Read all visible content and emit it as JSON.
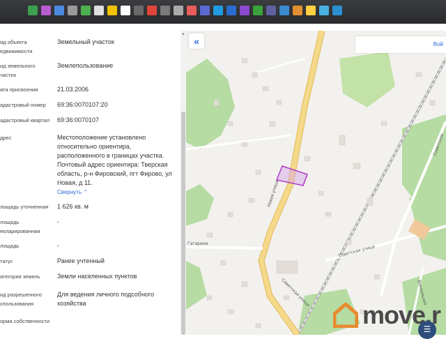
{
  "taskbar": {
    "icons": [
      {
        "name": "books-icon",
        "color": "#3d9e4f"
      },
      {
        "name": "photo-icon",
        "color": "#b85cd0"
      },
      {
        "name": "share-icon",
        "color": "#4b8ae0"
      },
      {
        "name": "pen-icon",
        "color": "#9a9a9a"
      },
      {
        "name": "plus-icon",
        "color": "#4caf50"
      },
      {
        "name": "file-icon",
        "color": "#e0e0e0"
      },
      {
        "name": "torrent-icon",
        "color": "#f2c200"
      },
      {
        "name": "amazon-icon",
        "color": "#ffffff"
      },
      {
        "name": "grid-icon",
        "color": "#6a6a6a"
      },
      {
        "name": "chrome-icon",
        "color": "#e04438"
      },
      {
        "name": "folder-icon",
        "color": "#7a7a7a"
      },
      {
        "name": "wrench-icon",
        "color": "#aaaaaa"
      },
      {
        "name": "mail-icon",
        "color": "#e85c5c"
      },
      {
        "name": "tools-icon",
        "color": "#5a6ad0"
      },
      {
        "name": "skype-icon",
        "color": "#1e9be0"
      },
      {
        "name": "psd-icon",
        "color": "#2b6cd0"
      },
      {
        "name": "pre-icon",
        "color": "#8c4ad0"
      },
      {
        "name": "terminal-icon",
        "color": "#3aa23a"
      },
      {
        "name": "media-icon",
        "color": "#6060a0"
      },
      {
        "name": "game-icon",
        "color": "#3a8ad0"
      },
      {
        "name": "flame-icon",
        "color": "#e09030"
      },
      {
        "name": "car-icon",
        "color": "#ffd040"
      },
      {
        "name": "browser-icon",
        "color": "#4ab0e0"
      },
      {
        "name": "edge-icon",
        "color": "#2a90d0"
      }
    ]
  },
  "property": {
    "rows": [
      {
        "label": "ид объекта\nедвижимости",
        "value": "Земельный участок"
      },
      {
        "label": "ид земельного\nчастка",
        "value": "Землепользование"
      },
      {
        "label": "ата присвоения",
        "value": "21.03.2006"
      },
      {
        "label": "адастровый номер",
        "value": "69:36:0070107:20"
      },
      {
        "label": "адастровый квартал",
        "value": "69:36:0070107"
      },
      {
        "label": "дрес",
        "value": "Местоположение установлено относительно ориентира, расположенного в границах участка. Почтовый адрес ориентира: Тверская область, р-н Фировский, пгт Фирово, ул Новая, д 11."
      },
      {
        "label": "лощадь уточненная",
        "value": "1 626 кв. м"
      },
      {
        "label": "лощадь\nекларированная",
        "value": "-"
      },
      {
        "label": "лощадь",
        "value": "-"
      },
      {
        "label": "татус",
        "value": "Ранее учтенный"
      },
      {
        "label": "атегория земель",
        "value": "Земли населенных пунктов"
      },
      {
        "label": "ид разрешенного\nспользования",
        "value": "Для ведения личного подсобного хозяйства"
      },
      {
        "label": "орма собственности",
        "value": ""
      }
    ],
    "collapse_label": "Свернуть",
    "collapse_icon": "chevron-up-icon"
  },
  "map": {
    "back_icon": "double-chevron-left-icon",
    "search_text": "Вой",
    "streets": {
      "novaya": "Новая улица",
      "gagarina": "Гагарина",
      "sovetskaya": "Советская улица",
      "sovetskaya2": "Советская",
      "vokzalnaya": "Вокзальная"
    },
    "colors": {
      "road_main": "#f5d98a",
      "road_edge": "#e0b95a",
      "forest": "#b6dca3",
      "parcel": "#b03cc8",
      "building": "#e2ddd7"
    }
  },
  "watermark": {
    "text": "move.r",
    "logo_color": "#e88a2e"
  }
}
